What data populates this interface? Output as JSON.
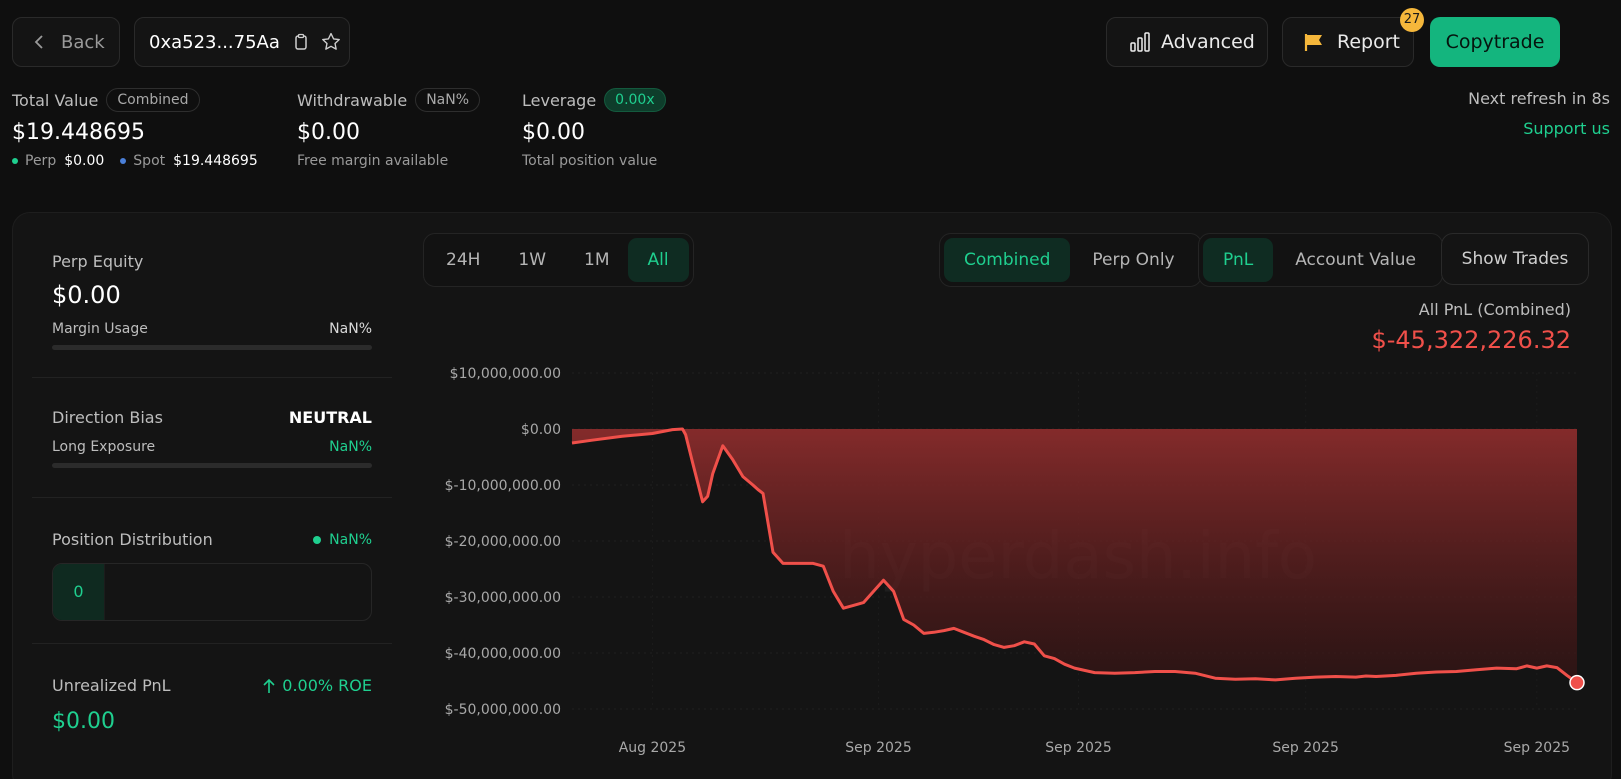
{
  "header": {
    "back_label": "Back",
    "address": "0xa523...75Aa",
    "advanced_label": "Advanced",
    "report_label": "Report",
    "report_badge": "27",
    "copytrade_label": "Copytrade"
  },
  "stats": {
    "total_value_label": "Total Value",
    "total_value_pill": "Combined",
    "total_value": "$19.448695",
    "perp_label": "Perp",
    "perp_value": "$0.00",
    "spot_label": "Spot",
    "spot_value": "$19.448695",
    "withdrawable_label": "Withdrawable",
    "withdrawable_pill": "NaN%",
    "withdrawable_value": "$0.00",
    "withdrawable_sub": "Free margin available",
    "leverage_label": "Leverage",
    "leverage_pill": "0.00x",
    "leverage_value": "$0.00",
    "leverage_sub": "Total position value",
    "refresh_text": "Next refresh in 8s",
    "support_link": "Support us"
  },
  "left_panel": {
    "perp_equity_label": "Perp Equity",
    "perp_equity_value": "$0.00",
    "margin_usage_label": "Margin Usage",
    "margin_usage_value": "NaN%",
    "direction_bias_label": "Direction Bias",
    "direction_bias_value": "NEUTRAL",
    "long_exposure_label": "Long Exposure",
    "long_exposure_value": "NaN%",
    "position_distribution_label": "Position Distribution",
    "position_distribution_value": "NaN%",
    "position_count": "0",
    "unrealized_pnl_label": "Unrealized PnL",
    "roe_text": "0.00% ROE",
    "unrealized_pnl_value": "$0.00"
  },
  "chart_controls": {
    "ranges": [
      "24H",
      "1W",
      "1M",
      "All"
    ],
    "active_range": "All",
    "scope": [
      "Combined",
      "Perp Only"
    ],
    "active_scope": "Combined",
    "metric": [
      "PnL",
      "Account Value"
    ],
    "active_metric": "PnL",
    "show_trades_label": "Show Trades"
  },
  "chart_summary": {
    "title": "All PnL (Combined)",
    "value": "$-45,322,226.32",
    "watermark": "hyperdash.info"
  },
  "colors": {
    "accent": "#1fcf8f",
    "negative": "#f0504a",
    "background": "#0f0f0f"
  },
  "chart_data": {
    "type": "area",
    "y_ticks": [
      "$10,000,000.00",
      "$0.00",
      "$-10,000,000.00",
      "$-20,000,000.00",
      "$-30,000,000.00",
      "$-40,000,000.00",
      "$-50,000,000.00"
    ],
    "x_ticks": [
      "Aug 2025",
      "Sep 2025",
      "Sep 2025",
      "Sep 2025",
      "Sep 2025"
    ],
    "ylim": [
      -50000000,
      10000000
    ],
    "grid": true,
    "series": [
      {
        "x": [
          0,
          0.02,
          0.05,
          0.08,
          0.1,
          0.11,
          0.113,
          0.12,
          0.13,
          0.135,
          0.14,
          0.15,
          0.16,
          0.17,
          0.18,
          0.185,
          0.19,
          0.2,
          0.21,
          0.215,
          0.22,
          0.23,
          0.24,
          0.25,
          0.26,
          0.27,
          0.28,
          0.29,
          0.3,
          0.31,
          0.32,
          0.33,
          0.34,
          0.35,
          0.36,
          0.37,
          0.38,
          0.39,
          0.4,
          0.41,
          0.42,
          0.43,
          0.44,
          0.45,
          0.46,
          0.47,
          0.48,
          0.49,
          0.5,
          0.52,
          0.54,
          0.56,
          0.58,
          0.6,
          0.62,
          0.64,
          0.66,
          0.68,
          0.7,
          0.72,
          0.74,
          0.76,
          0.78,
          0.79,
          0.8,
          0.82,
          0.84,
          0.86,
          0.88,
          0.9,
          0.92,
          0.94,
          0.95,
          0.96,
          0.97,
          0.98,
          0.99,
          1.0
        ],
        "values": [
          -2500000,
          -2000000,
          -1300000,
          -800000,
          -100000,
          0,
          -1000000,
          -6000000,
          -13000000,
          -12000000,
          -8000000,
          -3000000,
          -5500000,
          -8500000,
          -10000000,
          -10800000,
          -11500000,
          -22000000,
          -24000000,
          -24000000,
          -24000000,
          -24000000,
          -24000000,
          -24500000,
          -29000000,
          -32000000,
          -31500000,
          -31000000,
          -29000000,
          -27000000,
          -29000000,
          -34000000,
          -35000000,
          -36500000,
          -36300000,
          -36000000,
          -35600000,
          -36300000,
          -37000000,
          -37600000,
          -38500000,
          -39000000,
          -38700000,
          -38000000,
          -38400000,
          -40500000,
          -41000000,
          -42000000,
          -42700000,
          -43500000,
          -43600000,
          -43500000,
          -43300000,
          -43300000,
          -43600000,
          -44500000,
          -44700000,
          -44600000,
          -44800000,
          -44500000,
          -44300000,
          -44200000,
          -44300000,
          -44100000,
          -44200000,
          -44000000,
          -43600000,
          -43400000,
          -43300000,
          -43000000,
          -42700000,
          -42800000,
          -42300000,
          -42700000,
          -42300000,
          -42600000,
          -44000000,
          -45300000
        ]
      }
    ]
  }
}
